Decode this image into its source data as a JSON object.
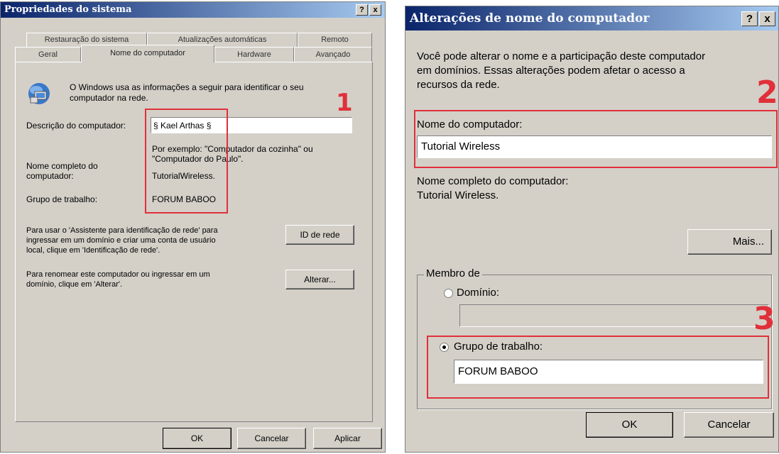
{
  "left": {
    "title": "Propriedades do sistema",
    "help": "?",
    "close": "x",
    "tabs_back": [
      "Restauração do sistema",
      "Atualizações automáticas",
      "Remoto"
    ],
    "tabs_front": [
      "Geral",
      "Nome do computador",
      "Hardware",
      "Avançado"
    ],
    "intro_line1": "O Windows usa as informações a seguir para identificar o seu",
    "intro_line2": "computador na rede.",
    "desc_label": "Descrição do computador:",
    "desc_value": "§ Kael Arthas §",
    "example_line1": "Por exemplo: \"Computador da cozinha\" ou",
    "example_line2": "\"Computador do Paulo\".",
    "fullname_label1": "Nome completo do",
    "fullname_label2": "computador:",
    "fullname_value": "TutorialWireless.",
    "workgroup_label": "Grupo de trabalho:",
    "workgroup_value": "FORUM BABOO",
    "network_text1": "Para usar o 'Assistente para identificação de rede' para",
    "network_text2": "ingressar em um domínio e criar uma conta de usuário",
    "network_text3": "local, clique em 'Identificação de rede'.",
    "network_button": "ID de rede",
    "rename_text1": "Para renomear este computador ou ingressar em um",
    "rename_text2": "domínio, clique em 'Alterar'.",
    "rename_button": "Alterar...",
    "ok": "OK",
    "cancel": "Cancelar",
    "apply": "Aplicar",
    "annotation": "1"
  },
  "right": {
    "title": "Alterações de nome do computador",
    "help": "?",
    "close": "x",
    "intro_line1": "Você pode alterar o nome e a participação deste computador",
    "intro_line2": "em domínios. Essas alterações podem afetar o acesso a",
    "intro_line3": "recursos da rede.",
    "name_label": "Nome do computador:",
    "name_value": "Tutorial Wireless",
    "fullname_label": "Nome completo do computador:",
    "fullname_value": "Tutorial Wireless.",
    "more_button": "Mais...",
    "member_label": "Membro de",
    "domain_label": "Domínio:",
    "domain_value": "",
    "workgroup_label": "Grupo de trabalho:",
    "workgroup_value": "FORUM BABOO",
    "ok": "OK",
    "cancel": "Cancelar",
    "annotation_2": "2",
    "annotation_3": "3"
  }
}
